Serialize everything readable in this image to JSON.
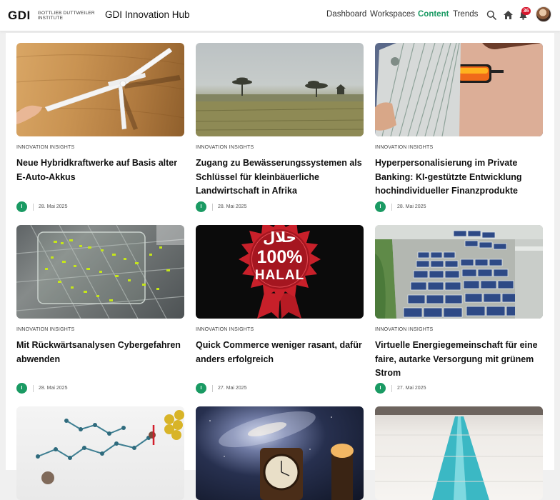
{
  "header": {
    "logo_mark": "GDI",
    "logo_sub_line1": "GOTTLIEB DUTTWEILER",
    "logo_sub_line2": "INSTITUTE",
    "app_title": "GDI Innovation Hub",
    "nav": [
      {
        "label": "Dashboard",
        "active": false
      },
      {
        "label": "Workspaces",
        "active": false
      },
      {
        "label": "Content",
        "active": true
      },
      {
        "label": "Trends",
        "active": false
      }
    ],
    "notification_count": "36",
    "icons": [
      "search-icon",
      "home-icon",
      "bell-icon",
      "avatar"
    ],
    "accent_color": "#1a9a63"
  },
  "cards": [
    {
      "category": "INNOVATION INSIGHTS",
      "title": "Neue Hybridkraftwerke auf Basis alter E-Auto-Akkus",
      "author_initial": "I",
      "date": "28. Mai 2025"
    },
    {
      "category": "INNOVATION INSIGHTS",
      "title": "Zugang zu Bewässerungssystemen als Schlüssel für kleinbäuerliche Landwirtschaft in Afrika",
      "author_initial": "I",
      "date": "28. Mai 2025"
    },
    {
      "category": "INNOVATION INSIGHTS",
      "title": "Hyperpersonalisierung im Private Banking: KI-gestützte Entwicklung hochindividueller Finanzprodukte",
      "author_initial": "I",
      "date": "28. Mai 2025"
    },
    {
      "category": "INNOVATION INSIGHTS",
      "title": "Mit Rückwärtsanalysen Cybergefahren abwenden",
      "author_initial": "I",
      "date": "28. Mai 2025"
    },
    {
      "category": "INNOVATION INSIGHTS",
      "title": "Quick Commerce weniger rasant, dafür anders erfolgreich",
      "author_initial": "I",
      "date": "27. Mai 2025"
    },
    {
      "category": "INNOVATION INSIGHTS",
      "title": "Virtuelle Energiegemeinschaft für eine faire, autarke Versorgung mit grünem Strom",
      "author_initial": "I",
      "date": "27. Mai 2025"
    }
  ],
  "halal_badge": {
    "arabic": "حلال",
    "percent": "100%",
    "word": "HALAL"
  }
}
